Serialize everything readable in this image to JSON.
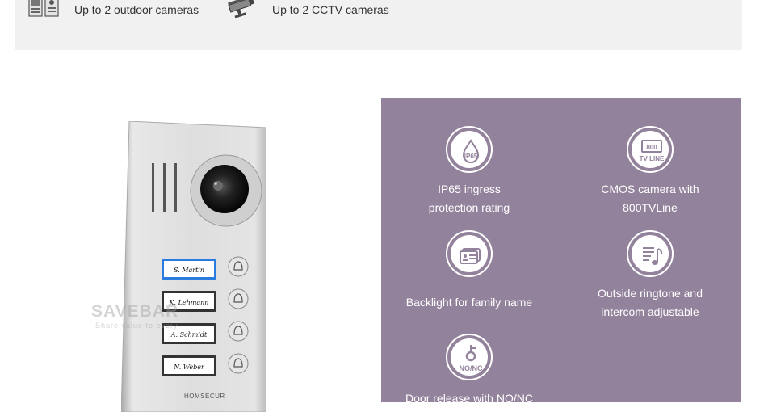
{
  "top_band": {
    "items": [
      {
        "label": "Up to 2 outdoor cameras",
        "icon": "outdoor-camera-icon"
      },
      {
        "label": "Up to 2 CCTV cameras",
        "icon": "cctv-camera-icon"
      }
    ]
  },
  "product": {
    "watermark": "SAVEBAR",
    "watermark_sub": "Share value to every",
    "brand": "HOMSECUR",
    "nameplates": [
      "S. Martin",
      "K. Lehmann",
      "A. Schmidt",
      "N. Weber"
    ]
  },
  "features": {
    "panel_color": "#93829b",
    "items": [
      {
        "lines": [
          "IP65 ingress",
          "protection rating"
        ],
        "icon": "ip65-icon",
        "badge": "IP65"
      },
      {
        "lines": [
          "CMOS camera with",
          "800TVLine"
        ],
        "icon": "tv-line-icon",
        "badge_top": "800",
        "badge_bottom": "TV LINE"
      },
      {
        "lines": [
          "Backlight for family name"
        ],
        "icon": "nameplate-icon"
      },
      {
        "lines": [
          "Outside ringtone and",
          "intercom adjustable"
        ],
        "icon": "music-note-icon"
      },
      {
        "lines": [
          "Door release with NO/NC"
        ],
        "icon": "door-release-icon",
        "badge": "NO/NC"
      }
    ]
  }
}
